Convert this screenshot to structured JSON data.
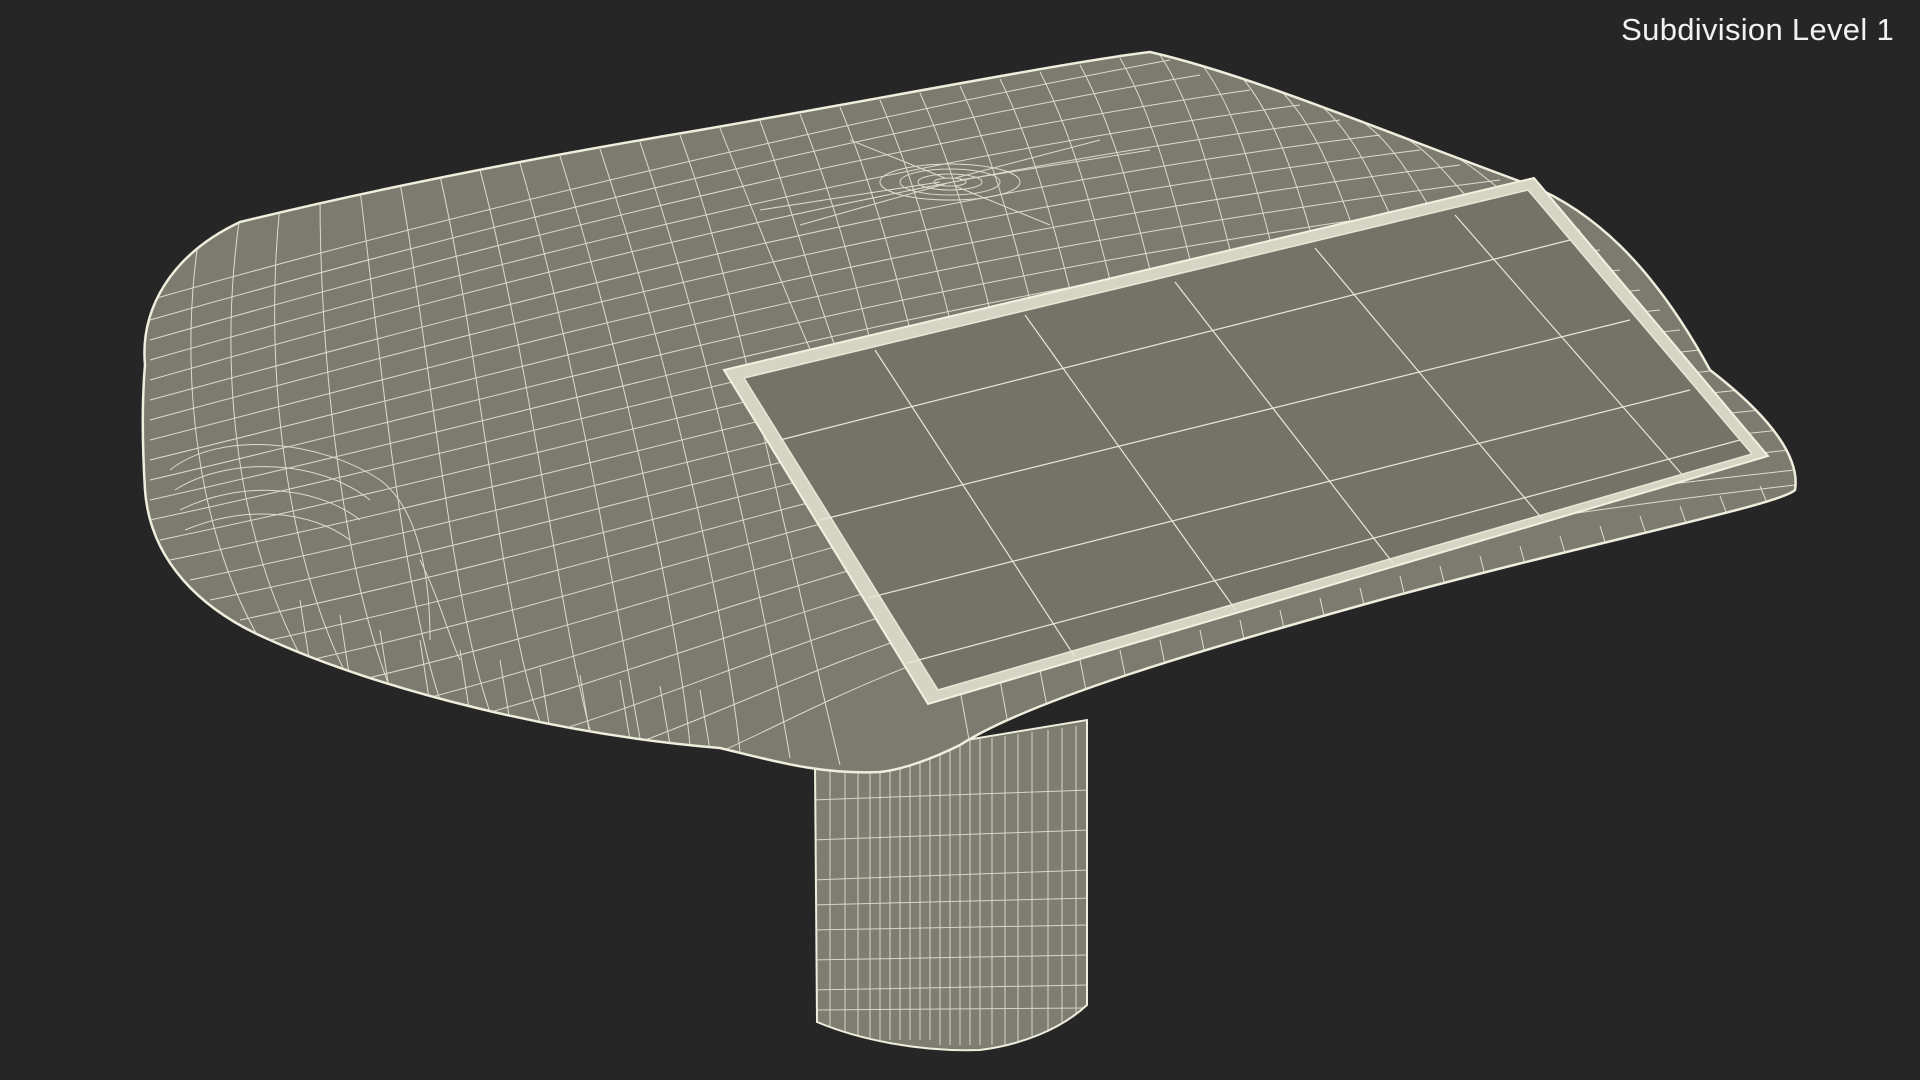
{
  "overlay": {
    "subdivision_label": "Subdivision Level 1"
  },
  "colors": {
    "background": "#262626",
    "surface": "#7a7a6f",
    "panel": "#75756b",
    "wire": "#e9e7d6"
  }
}
